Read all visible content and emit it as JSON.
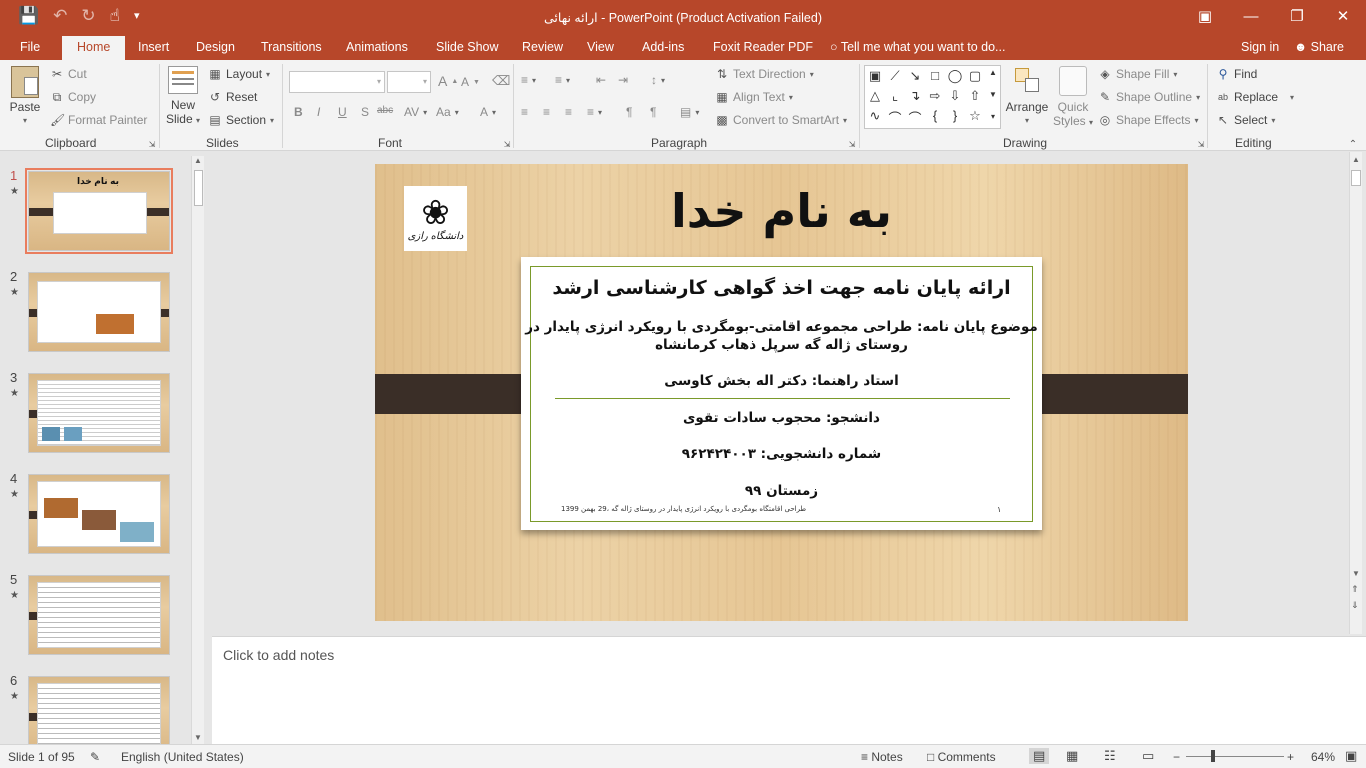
{
  "titlebar": {
    "title": "ارائه نهائی - PowerPoint (Product Activation Failed)",
    "qat": [
      "save-icon",
      "undo-icon",
      "redo-icon",
      "touch-mode-icon",
      "customize-icon"
    ]
  },
  "tabs": {
    "file": "File",
    "home": "Home",
    "insert": "Insert",
    "design": "Design",
    "transitions": "Transitions",
    "animations": "Animations",
    "slideshow": "Slide Show",
    "review": "Review",
    "view": "View",
    "addins": "Add-ins",
    "foxit": "Foxit Reader PDF",
    "tellme": "Tell me what you want to do...",
    "signin": "Sign in",
    "share": "Share"
  },
  "ribbon": {
    "clipboard": {
      "paste": "Paste",
      "cut": "Cut",
      "copy": "Copy",
      "format_painter": "Format Painter",
      "label": "Clipboard"
    },
    "slides": {
      "new_slide_1": "New",
      "new_slide_2": "Slide",
      "layout": "Layout",
      "reset": "Reset",
      "section": "Section",
      "label": "Slides"
    },
    "font": {
      "label": "Font",
      "bold": "B",
      "italic": "I",
      "underline": "U",
      "shadow": "S",
      "strike": "abc",
      "aa": "Aa",
      "grow": "A",
      "shrink": "A"
    },
    "paragraph": {
      "text_direction": "Text Direction",
      "align_text": "Align Text",
      "convert_smartart": "Convert to SmartArt",
      "label": "Paragraph"
    },
    "drawing": {
      "arrange": "Arrange",
      "quick_styles_1": "Quick",
      "quick_styles_2": "Styles",
      "shape_fill": "Shape Fill",
      "shape_outline": "Shape Outline",
      "shape_effects": "Shape Effects",
      "label": "Drawing"
    },
    "editing": {
      "find": "Find",
      "replace": "Replace",
      "select": "Select",
      "label": "Editing"
    }
  },
  "thumbnails": [
    {
      "num": "1",
      "title": "به نام خدا"
    },
    {
      "num": "2",
      "title": ""
    },
    {
      "num": "3",
      "title": ""
    },
    {
      "num": "4",
      "title": ""
    },
    {
      "num": "5",
      "title": ""
    },
    {
      "num": "6",
      "title": ""
    }
  ],
  "slide": {
    "title": "به نام خدا",
    "logo_text": "دانشگاه رازی",
    "heading": "ارائه پایان نامه جهت اخذ گواهی کارشناسی ارشد",
    "topic_line1": "موضوع پایان نامه: طراحی مجموعه اقامتی-بومگردی با رویکرد انرژی پایدار در",
    "topic_line2": "روستای ژاله گه سرپل ذهاب کرمانشاه",
    "advisor": "استاد راهنما: دکتر اله بخش کاوسی",
    "student": "دانشجو: محجوب سادات تقوی",
    "student_id": "شماره دانشجویی: ۹۶۲۴۲۴۰۰۳",
    "season": "زمستان ۹۹",
    "footer": "طراحی اقامتگاه بومگردی با رویکرد انرژی پایدار در روستای ژاله گه ،29 بهمن 1399",
    "page_num": "۱"
  },
  "notes": {
    "placeholder": "Click to add notes"
  },
  "status": {
    "slide_of": "Slide 1 of 95",
    "language": "English (United States)",
    "notes": "Notes",
    "comments": "Comments",
    "zoom": "64%"
  },
  "colors": {
    "accent": "#b7472a",
    "selection": "#e97d5e",
    "band": "#3a2e27",
    "frame": "#7a9a2a"
  }
}
